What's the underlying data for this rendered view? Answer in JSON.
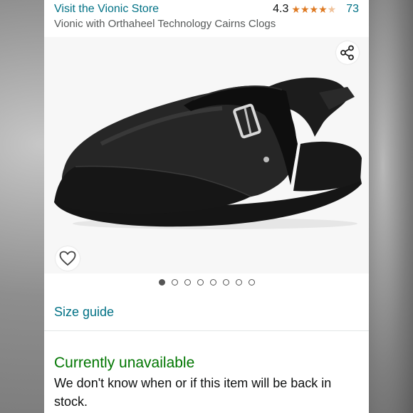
{
  "store": {
    "link_text": "Visit the Vionic Store",
    "rating_value": "4.3",
    "rating_stars": 4.3,
    "rating_count": "73"
  },
  "product": {
    "title": "Vionic with Orthaheel Technology Cairns Clogs"
  },
  "gallery": {
    "image_count": 8,
    "active_index": 0,
    "share_icon": "share-icon",
    "wishlist_icon": "heart-icon"
  },
  "links": {
    "size_guide": "Size guide"
  },
  "availability": {
    "status": "Currently unavailable",
    "note": "We don't know when or if this item will be back in stock.",
    "status_color": "#007600"
  },
  "colors": {
    "link": "#007185",
    "star": "#de7921"
  }
}
